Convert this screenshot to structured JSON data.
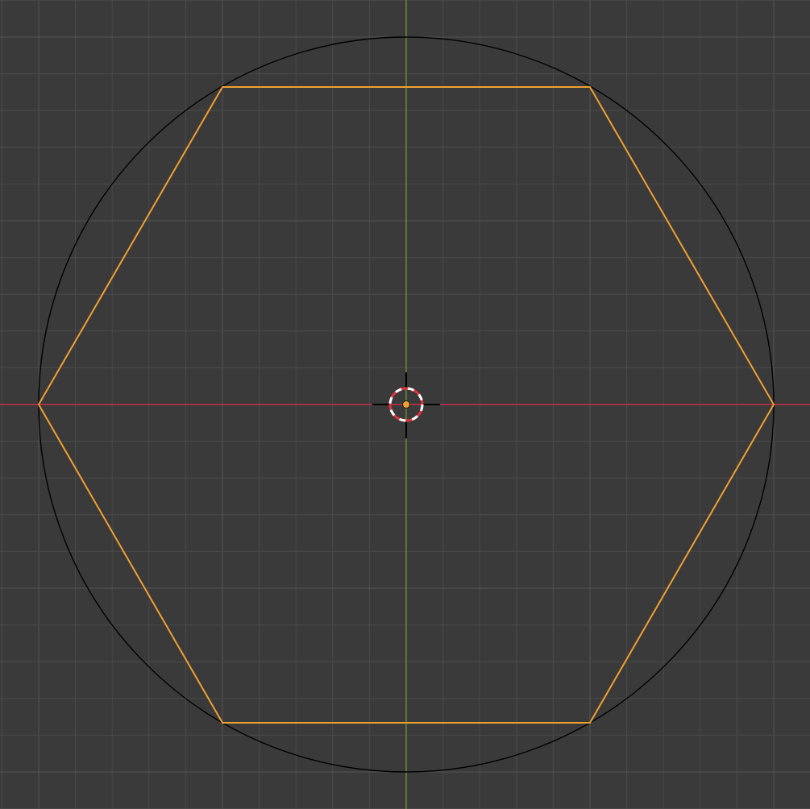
{
  "viewport": {
    "view": "top-orthographic",
    "background_color": "#3a3a3a",
    "grid": {
      "visible": true,
      "minor_color": "#4a4a4a",
      "major_color": "#545454"
    },
    "axes": {
      "x_axis_color": "#c4304a",
      "y_axis_color": "#7a9b2a"
    }
  },
  "objects": [
    {
      "name": "circle-object",
      "type": "circle",
      "color": "#000000",
      "selected": false
    },
    {
      "name": "hexagon-object",
      "type": "polygon",
      "sides": 6,
      "color": "#f0a030",
      "selected": true
    }
  ],
  "cursor_3d": {
    "ring_color_a": "#e0343c",
    "ring_color_b": "#ffffff",
    "crosshair_color": "#000000"
  },
  "origin": {
    "color": "#f0a030"
  }
}
